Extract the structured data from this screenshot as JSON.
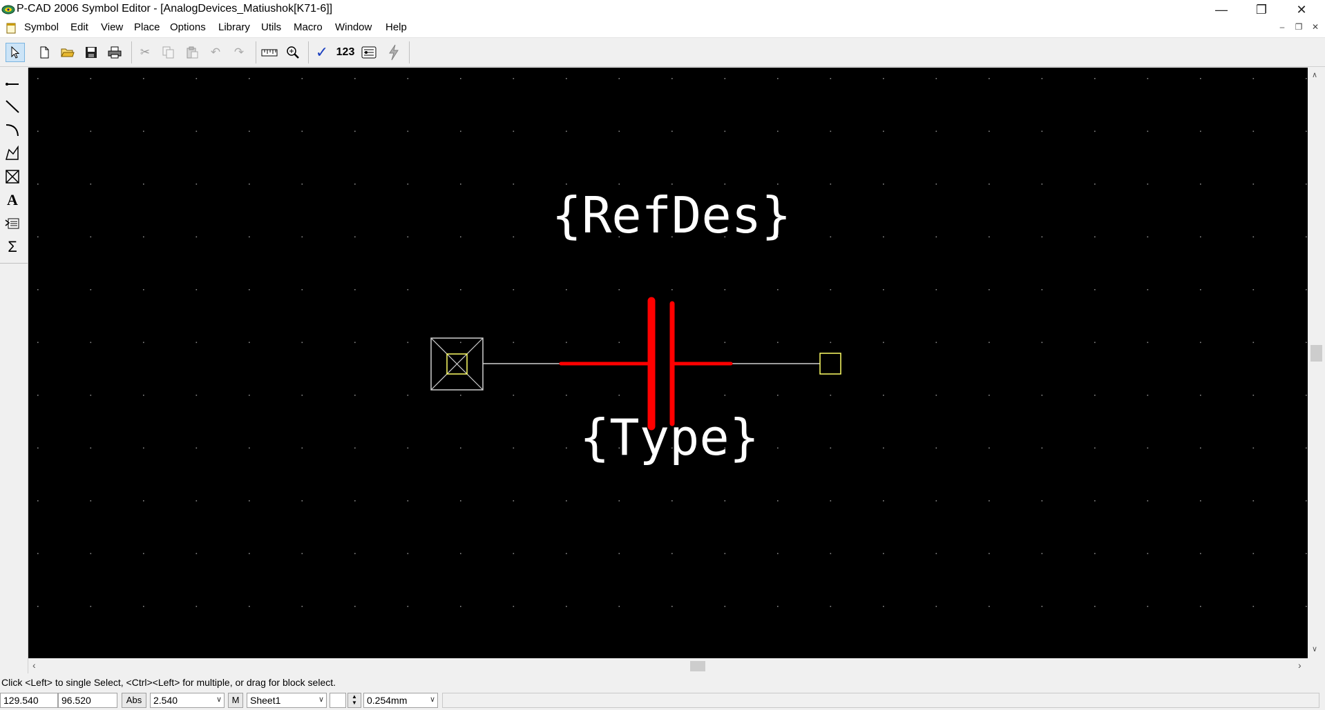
{
  "window": {
    "title": "P-CAD 2006 Symbol Editor - [AnalogDevices_Matiushok[K71-6]]",
    "controls": {
      "minimize": "—",
      "restore": "❐",
      "close": "✕"
    }
  },
  "menu": {
    "items": [
      "Symbol",
      "Edit",
      "View",
      "Place",
      "Options",
      "Library",
      "Utils",
      "Macro",
      "Window",
      "Help"
    ],
    "mdi_controls": {
      "minimize": "–",
      "restore": "❐",
      "close": "✕"
    }
  },
  "toolbar": {
    "numbering_label": "123",
    "icons": [
      "select-arrow-icon",
      "new-file-icon",
      "open-folder-icon",
      "save-icon",
      "print-icon",
      "cut-icon",
      "copy-icon",
      "paste-icon",
      "undo-icon",
      "redo-icon",
      "measure-ruler-icon",
      "zoom-icon",
      "validate-check-icon",
      "renumber-icon",
      "symbol-wizard-icon",
      "lightning-icon"
    ]
  },
  "left_toolbar": {
    "icons": [
      "place-pin-icon",
      "place-line-icon",
      "place-arc-icon",
      "place-polygon-icon",
      "place-ref-point-icon",
      "place-text-icon",
      "place-attribute-icon",
      "place-field-icon"
    ]
  },
  "canvas": {
    "background": "#000000",
    "refdes_text": "{RefDes}",
    "type_text": "{Type}",
    "colors": {
      "grid": "#8a8a8a",
      "symbol": "#ff0000",
      "pin_line": "#cfcfcf",
      "pin_marker": "#ffff66",
      "text": "#ffffff"
    }
  },
  "status": {
    "message": "Click <Left> to single Select, <Ctrl><Left> for multiple, or drag for block select.",
    "x_coord": "129.540",
    "y_coord": "96.520",
    "abs_label": "Abs",
    "grid_value": "2.540",
    "m_label": "M",
    "sheet": "Sheet1",
    "line_width": "0.254mm"
  }
}
